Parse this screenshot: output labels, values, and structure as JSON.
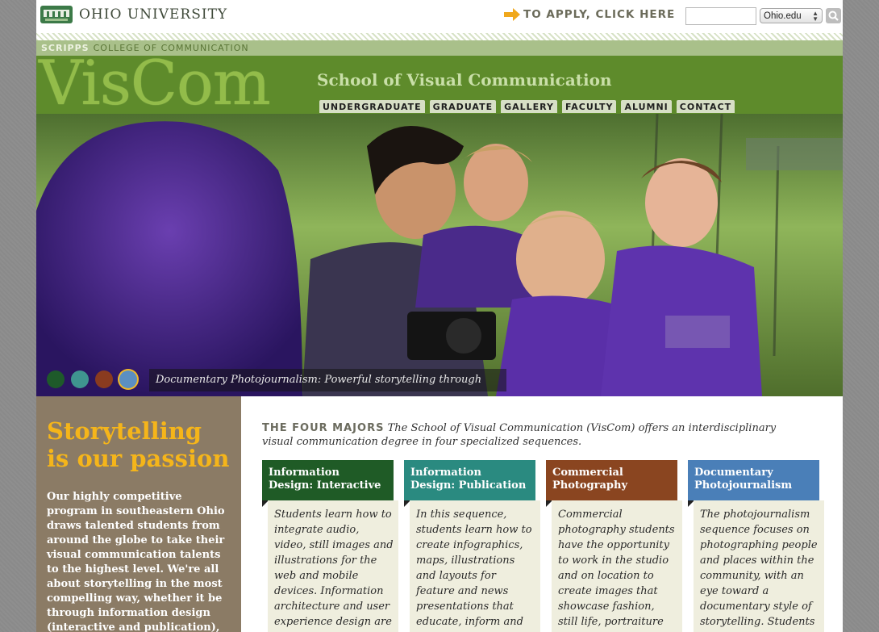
{
  "topbar": {
    "university_name": "OHIO UNIVERSITY",
    "apply_text": "TO APPLY, CLICK HERE",
    "search_placeholder": "",
    "search_scope": "Ohio.edu"
  },
  "college_bar": {
    "scripps": "SCRIPPS",
    "college": "COLLEGE OF COMMUNICATION"
  },
  "header": {
    "logo_text": "VisCom",
    "school_name": "School of Visual Communication",
    "nav": [
      "UNDERGRADUATE",
      "GRADUATE",
      "GALLERY",
      "FACULTY",
      "ALUMNI",
      "CONTACT"
    ]
  },
  "hero": {
    "slide_dots": [
      {
        "color": "#1e5a2a",
        "active": false
      },
      {
        "color": "#3f958f",
        "active": false
      },
      {
        "color": "#8a3b1f",
        "active": false
      },
      {
        "color": "#5b8fc2",
        "active": true
      }
    ],
    "caption": "Documentary Photojournalism: Powerful storytelling through images."
  },
  "sidebar": {
    "title": "Storytelling is our passion",
    "body": "Our highly competitive program in southeastern Ohio draws talented students from around the globe to take their visual communication talents to the highest level. We're all about storytelling in the most compelling way, whether it be through information design (interactive and publication),"
  },
  "main": {
    "intro_heading": "THE FOUR MAJORS",
    "intro_text": "The School of Visual Communication (VisCom) offers an interdisciplinary visual communication degree in four specialized sequences.",
    "majors": [
      {
        "title": "Information Design: Interactive",
        "color": "#1f5b26",
        "body": "Students learn how to integrate audio, video, still images and illustrations for the web and mobile devices. Information architecture and user experience design are"
      },
      {
        "title": "Information Design: Publication",
        "color": "#2a8a80",
        "body": "In this sequence, students learn how to create infographics, maps, illustrations and layouts for feature and news presentations that educate, inform and enlighten readers"
      },
      {
        "title": "Commercial Photography",
        "color": "#8a4520",
        "body": "Commercial photography students have the opportunity to work in the studio and on location to create images that showcase fashion, still life, portraiture and"
      },
      {
        "title": "Documentary Photojournalism",
        "color": "#4a7fb8",
        "body": "The photojournalism sequence focuses on photographing people and places within the community, with an eye toward a documentary style of storytelling. Students learn the"
      }
    ]
  }
}
